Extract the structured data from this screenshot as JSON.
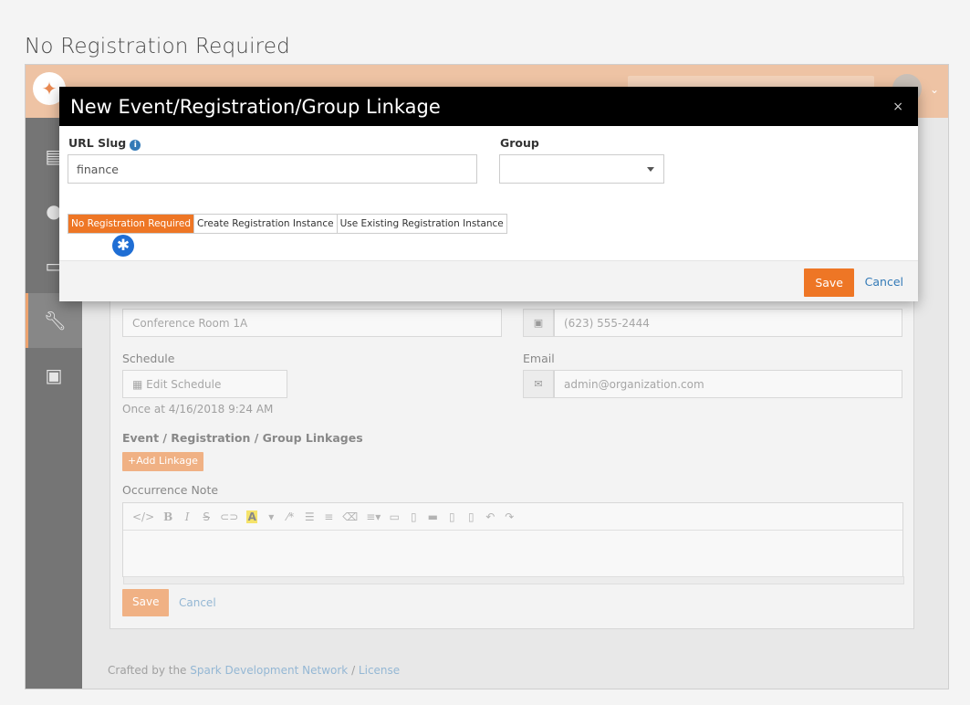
{
  "caption": "No Registration Required",
  "modal": {
    "title": "New Event/Registration/Group Linkage",
    "close": "×",
    "url_slug_label": "URL Slug",
    "url_slug_value": "finance",
    "group_label": "Group",
    "group_value": "",
    "tabs": [
      {
        "label": "No Registration Required",
        "active": true
      },
      {
        "label": "Create Registration Instance",
        "active": false
      },
      {
        "label": "Use Existing Registration Instance",
        "active": false
      }
    ],
    "asterisk": "✱",
    "save_label": "Save",
    "cancel_label": "Cancel"
  },
  "background_form": {
    "location_value": "Conference Room 1A",
    "phone_value": "(623) 555-2444",
    "schedule_label": "Schedule",
    "edit_schedule": "Edit Schedule",
    "schedule_text": "Once at 4/16/2018 9:24 AM",
    "email_label": "Email",
    "email_value": "admin@organization.com",
    "linkages_label": "Event / Registration / Group Linkages",
    "add_linkage": "Add Linkage",
    "occurrence_note_label": "Occurrence Note",
    "save_label": "Save",
    "cancel_label": "Cancel"
  },
  "footer": {
    "prefix": "Crafted by the ",
    "link1": "Spark Development Network",
    "sep": " / ",
    "link2": "License"
  },
  "colors": {
    "accent": "#ee7625",
    "modal_header": "#000000",
    "link": "#337ab7",
    "topbar": "#eec3a4",
    "sidebar": "#757575"
  }
}
